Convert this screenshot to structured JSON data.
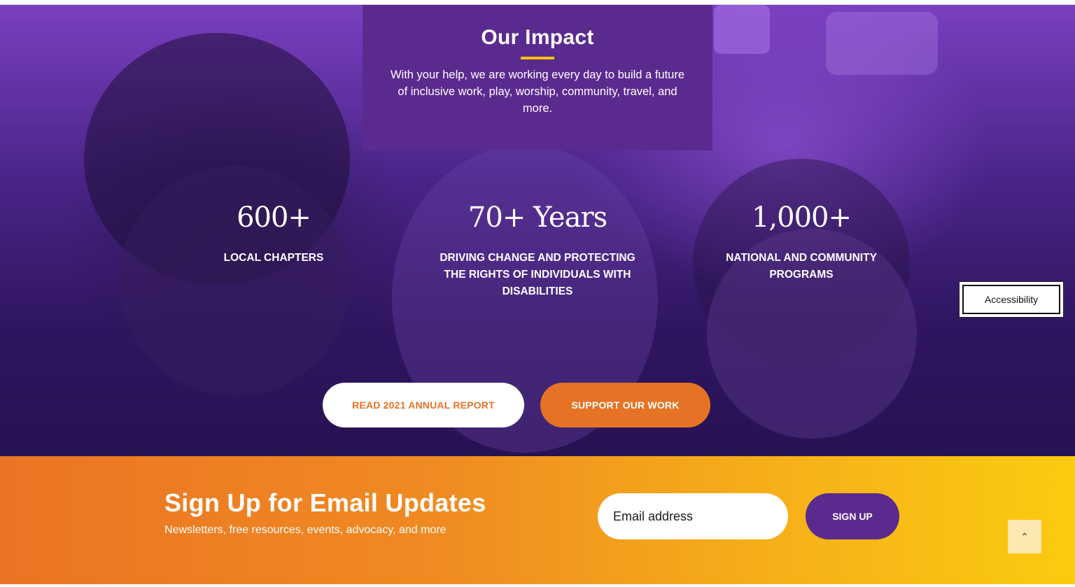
{
  "impact": {
    "title": "Our Impact",
    "text": "With your help, we are working every day to build a future of inclusive work, play, worship, community, travel, and more."
  },
  "stats": [
    {
      "number": "600+",
      "label": "LOCAL CHAPTERS"
    },
    {
      "number": "70+ Years",
      "label": "DRIVING CHANGE AND PROTECTING THE RIGHTS OF INDIVIDUALS WITH DISABILITIES"
    },
    {
      "number": "1,000+",
      "label": "NATIONAL AND COMMUNITY PROGRAMS"
    }
  ],
  "buttons": {
    "report": "READ 2021 ANNUAL REPORT",
    "support": "SUPPORT OUR WORK"
  },
  "accessibility": {
    "label": "Accessibility"
  },
  "signup": {
    "title": "Sign Up for Email Updates",
    "subtitle": "Newsletters, free resources, events, advocacy, and more",
    "placeholder": "Email address",
    "button": "SIGN UP"
  },
  "scroll_top": {
    "icon": "chevron-up-icon",
    "glyph": "⌃"
  },
  "colors": {
    "purple": "#5b2a8e",
    "orange": "#e67325",
    "yellow": "#f5c400"
  }
}
